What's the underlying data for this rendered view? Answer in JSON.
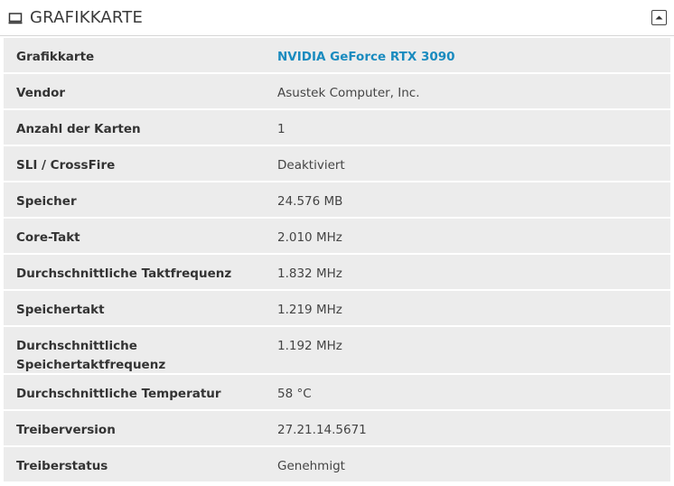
{
  "header": {
    "title": "GRAFIKKARTE",
    "icon": "monitor-icon",
    "collapse_icon": "collapse-icon"
  },
  "rows": [
    {
      "label": "Grafikkarte",
      "value": "NVIDIA GeForce RTX 3090",
      "link": true
    },
    {
      "label": "Vendor",
      "value": "Asustek Computer, Inc."
    },
    {
      "label": "Anzahl der Karten",
      "value": "1"
    },
    {
      "label": "SLI / CrossFire",
      "value": "Deaktiviert"
    },
    {
      "label": "Speicher",
      "value": "24.576 MB"
    },
    {
      "label": "Core-Takt",
      "value": "2.010 MHz"
    },
    {
      "label": "Durchschnittliche Taktfrequenz",
      "value": "1.832 MHz"
    },
    {
      "label": "Speichertakt",
      "value": "1.219 MHz"
    },
    {
      "label": "Durchschnittliche Speichertaktfrequenz",
      "value": "1.192 MHz",
      "label_lines": [
        "Durchschnittliche",
        "Speichertaktfrequenz"
      ]
    },
    {
      "label": "Durchschnittliche Temperatur",
      "value": "58 °C"
    },
    {
      "label": "Treiberversion",
      "value": "27.21.14.5671"
    },
    {
      "label": "Treiberstatus",
      "value": "Genehmigt"
    }
  ],
  "colors": {
    "link": "#1a8bbf",
    "row_bg": "#ececec"
  }
}
